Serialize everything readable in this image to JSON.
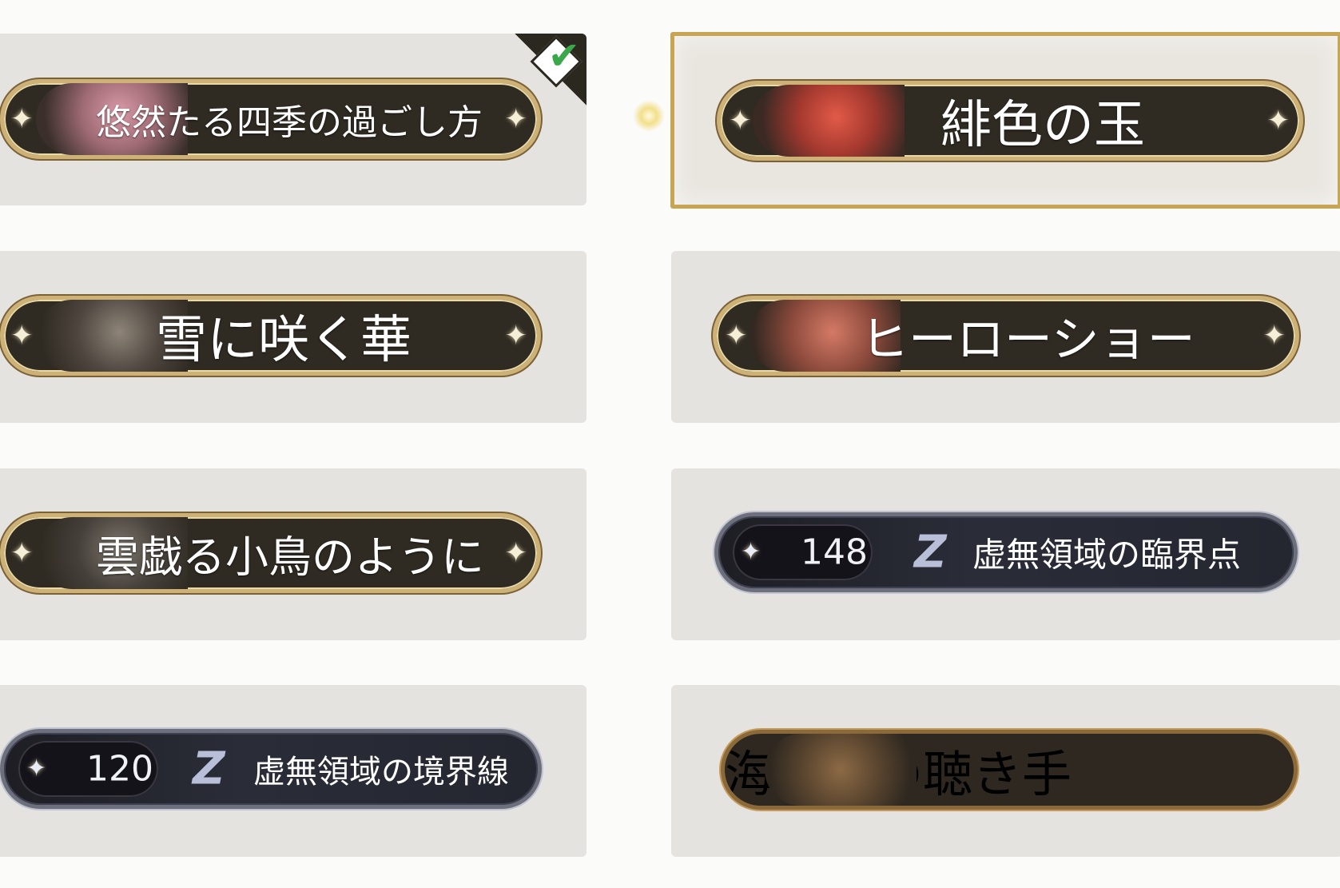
{
  "titles": {
    "t1": {
      "name": "悠然たる四季の過ごし方",
      "selected_mark": "check-icon"
    },
    "t2": {
      "name": "緋色の玉"
    },
    "t3": {
      "name": "雪に咲く華"
    },
    "t4": {
      "name": "ヒーローショー"
    },
    "t5": {
      "name": "雲戯る小鳥のように"
    },
    "t6": {
      "count": "148",
      "name": "虚無領域の臨界点"
    },
    "t7": {
      "count": "120",
      "name": "虚無領域の境界線"
    },
    "t8": {
      "name": "海鳴りの聴き手"
    }
  },
  "glyphs": {
    "spark": "✦",
    "void_logo": "Z",
    "check": "✔"
  },
  "colors": {
    "accent_gold": "#c8a552",
    "plate_dark": "#2f2a22",
    "check_green": "#3aa84a"
  }
}
